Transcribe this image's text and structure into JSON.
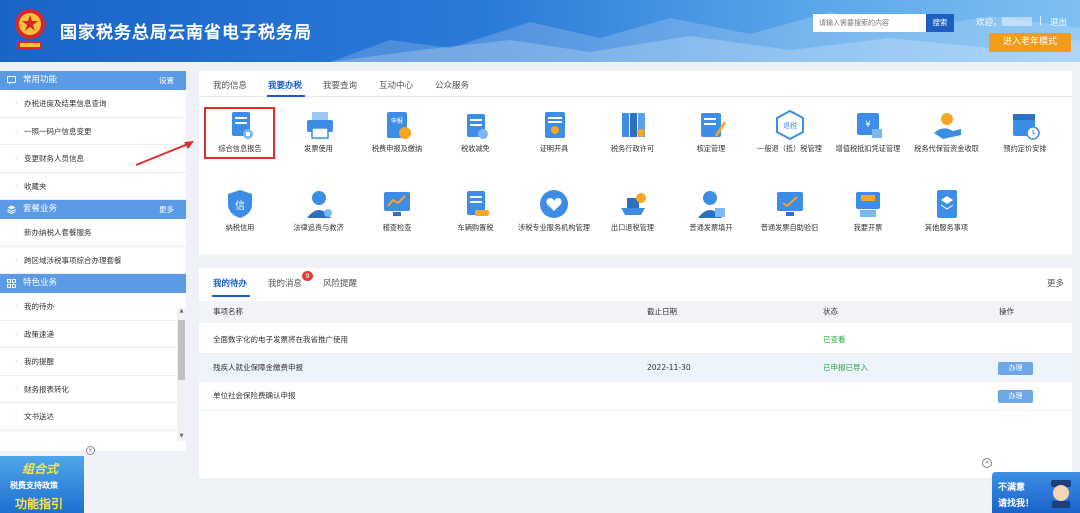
{
  "header": {
    "emblem_icon": "national-emblem-icon",
    "title": "国家税务总局云南省电子税务局",
    "search_placeholder": "请输入需要搜索的内容",
    "search_button": "搜索",
    "welcome": "欢迎，",
    "separator": "|",
    "logout": "退出",
    "elder_mode": "进入老年模式"
  },
  "sidebar": {
    "common": {
      "title": "常用功能",
      "action": "设置",
      "items": [
        "办税进度及结果信息查询",
        "一照一码户信息变更",
        "变更财务人员信息",
        "收藏夹"
      ]
    },
    "package": {
      "title": "套餐业务",
      "action": "更多",
      "items": [
        "新办纳税人套餐服务",
        "跨区域涉税事项综合办理套餐"
      ]
    },
    "special": {
      "title": "特色业务",
      "items": [
        "我的待办",
        "政策速递",
        "我的提醒",
        "财务报表转化",
        "文书送达"
      ]
    },
    "close": "×"
  },
  "promo": {
    "line1": "组合式",
    "line2": "税费支持政策",
    "line3": "功能指引"
  },
  "main": {
    "tabs": [
      "我的信息",
      "我要办税",
      "我要查询",
      "互动中心",
      "公众服务"
    ],
    "active_tab": "我要办税",
    "tiles_row1": [
      {
        "label": "综合信息报告",
        "icon": "info-report-icon"
      },
      {
        "label": "发票使用",
        "icon": "printer-icon"
      },
      {
        "label": "税费申报及缴纳",
        "icon": "tax-declare-icon"
      },
      {
        "label": "税收减免",
        "icon": "tax-relief-icon"
      },
      {
        "label": "证明开具",
        "icon": "certificate-icon"
      },
      {
        "label": "税务行政许可",
        "icon": "binders-icon"
      },
      {
        "label": "核定管理",
        "icon": "edit-document-icon"
      },
      {
        "label": "一般退（抵）税管理",
        "icon": "tax-refund-badge-icon"
      },
      {
        "label": "增值税抵扣凭证管理",
        "icon": "voucher-icon"
      },
      {
        "label": "税务代保管资金收取",
        "icon": "hand-coin-icon"
      },
      {
        "label": "预约定价安排",
        "icon": "calendar-clock-icon"
      }
    ],
    "tiles_row2": [
      {
        "label": "纳税信用",
        "icon": "credit-shield-icon"
      },
      {
        "label": "法律追责与救济",
        "icon": "legal-person-icon"
      },
      {
        "label": "稽查检查",
        "icon": "monitor-chart-icon"
      },
      {
        "label": "车辆购置税",
        "icon": "vehicle-tax-icon"
      },
      {
        "label": "涉税专业服务机构管理",
        "icon": "heart-hand-icon"
      },
      {
        "label": "出口退税管理",
        "icon": "export-ship-icon"
      },
      {
        "label": "普通发票填开",
        "icon": "invoice-person-icon"
      },
      {
        "label": "普通发票自助验旧",
        "icon": "monitor-check-icon"
      },
      {
        "label": "我要开票",
        "icon": "open-invoice-icon"
      },
      {
        "label": "其他服务事项",
        "icon": "other-services-icon"
      }
    ]
  },
  "todo": {
    "tabs": [
      "我的待办",
      "我的消息",
      "风险提醒"
    ],
    "message_badge": "9",
    "more": "更多",
    "columns": [
      "事项名称",
      "截止日期",
      "状态",
      "操作"
    ],
    "rows": [
      {
        "name": "全面数字化的电子发票将在我省推广使用",
        "date": "",
        "status": "已查看",
        "action": ""
      },
      {
        "name": "残疾人就业保障金缴费申报",
        "date": "2022-11-30",
        "status": "已申报已导入",
        "action": "办理"
      },
      {
        "name": "单位社会保险费确认申报",
        "date": "",
        "status": "",
        "action": "办理"
      }
    ],
    "close": "×"
  },
  "complaint": {
    "line1": "不满意",
    "line2": "请找我！"
  },
  "colors": {
    "header_blue": "#1a64c8",
    "sidebar_header": "#5b9ae4",
    "accent": "#1a5fc8",
    "highlight_red": "#e22c2c",
    "status_green": "#27a845",
    "elder_orange": "#f29c1c"
  }
}
